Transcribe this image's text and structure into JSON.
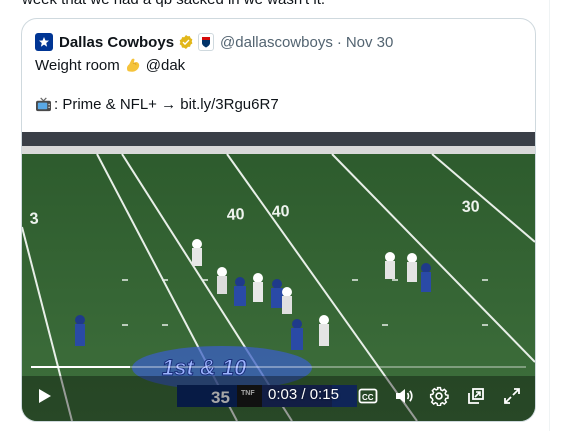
{
  "previous_tweet": {
    "text": "week that we had a qb sacked in we wasn't it."
  },
  "quote": {
    "author_name": "Dallas Cowboys",
    "handle": "@dallascowboys",
    "separator": "·",
    "date": "Nov 30",
    "line1_prefix": "Weight room",
    "line1_suffix": "@dak",
    "line2": ": Prime & NFL+ → bit.ly/3Rgu6R7"
  },
  "video": {
    "current_time": "0:03",
    "time_separator": " / ",
    "duration": "0:15",
    "progress_fraction": 0.2,
    "overlay": {
      "down_distance": "1st & 10",
      "score": "35",
      "network": "TNF"
    },
    "field_numbers": [
      "3",
      "40",
      "40",
      "30"
    ]
  },
  "colors": {
    "accent": "#1d9bf0",
    "brand_navy": "#003594",
    "verified_gold": "#e2b719",
    "field_green": "#3b6b3b"
  },
  "icons": {
    "avatar": "cowboys-star-icon",
    "verified": "verified-gold-badge-icon",
    "affiliate": "nfl-logo-icon",
    "emoji1": "flexed-biceps-emoji",
    "emoji2": "television-emoji",
    "play": "play-icon",
    "cc": "captions-icon",
    "volume": "volume-icon",
    "settings": "gear-icon",
    "popout": "dock-icon",
    "fullscreen": "fullscreen-icon"
  }
}
